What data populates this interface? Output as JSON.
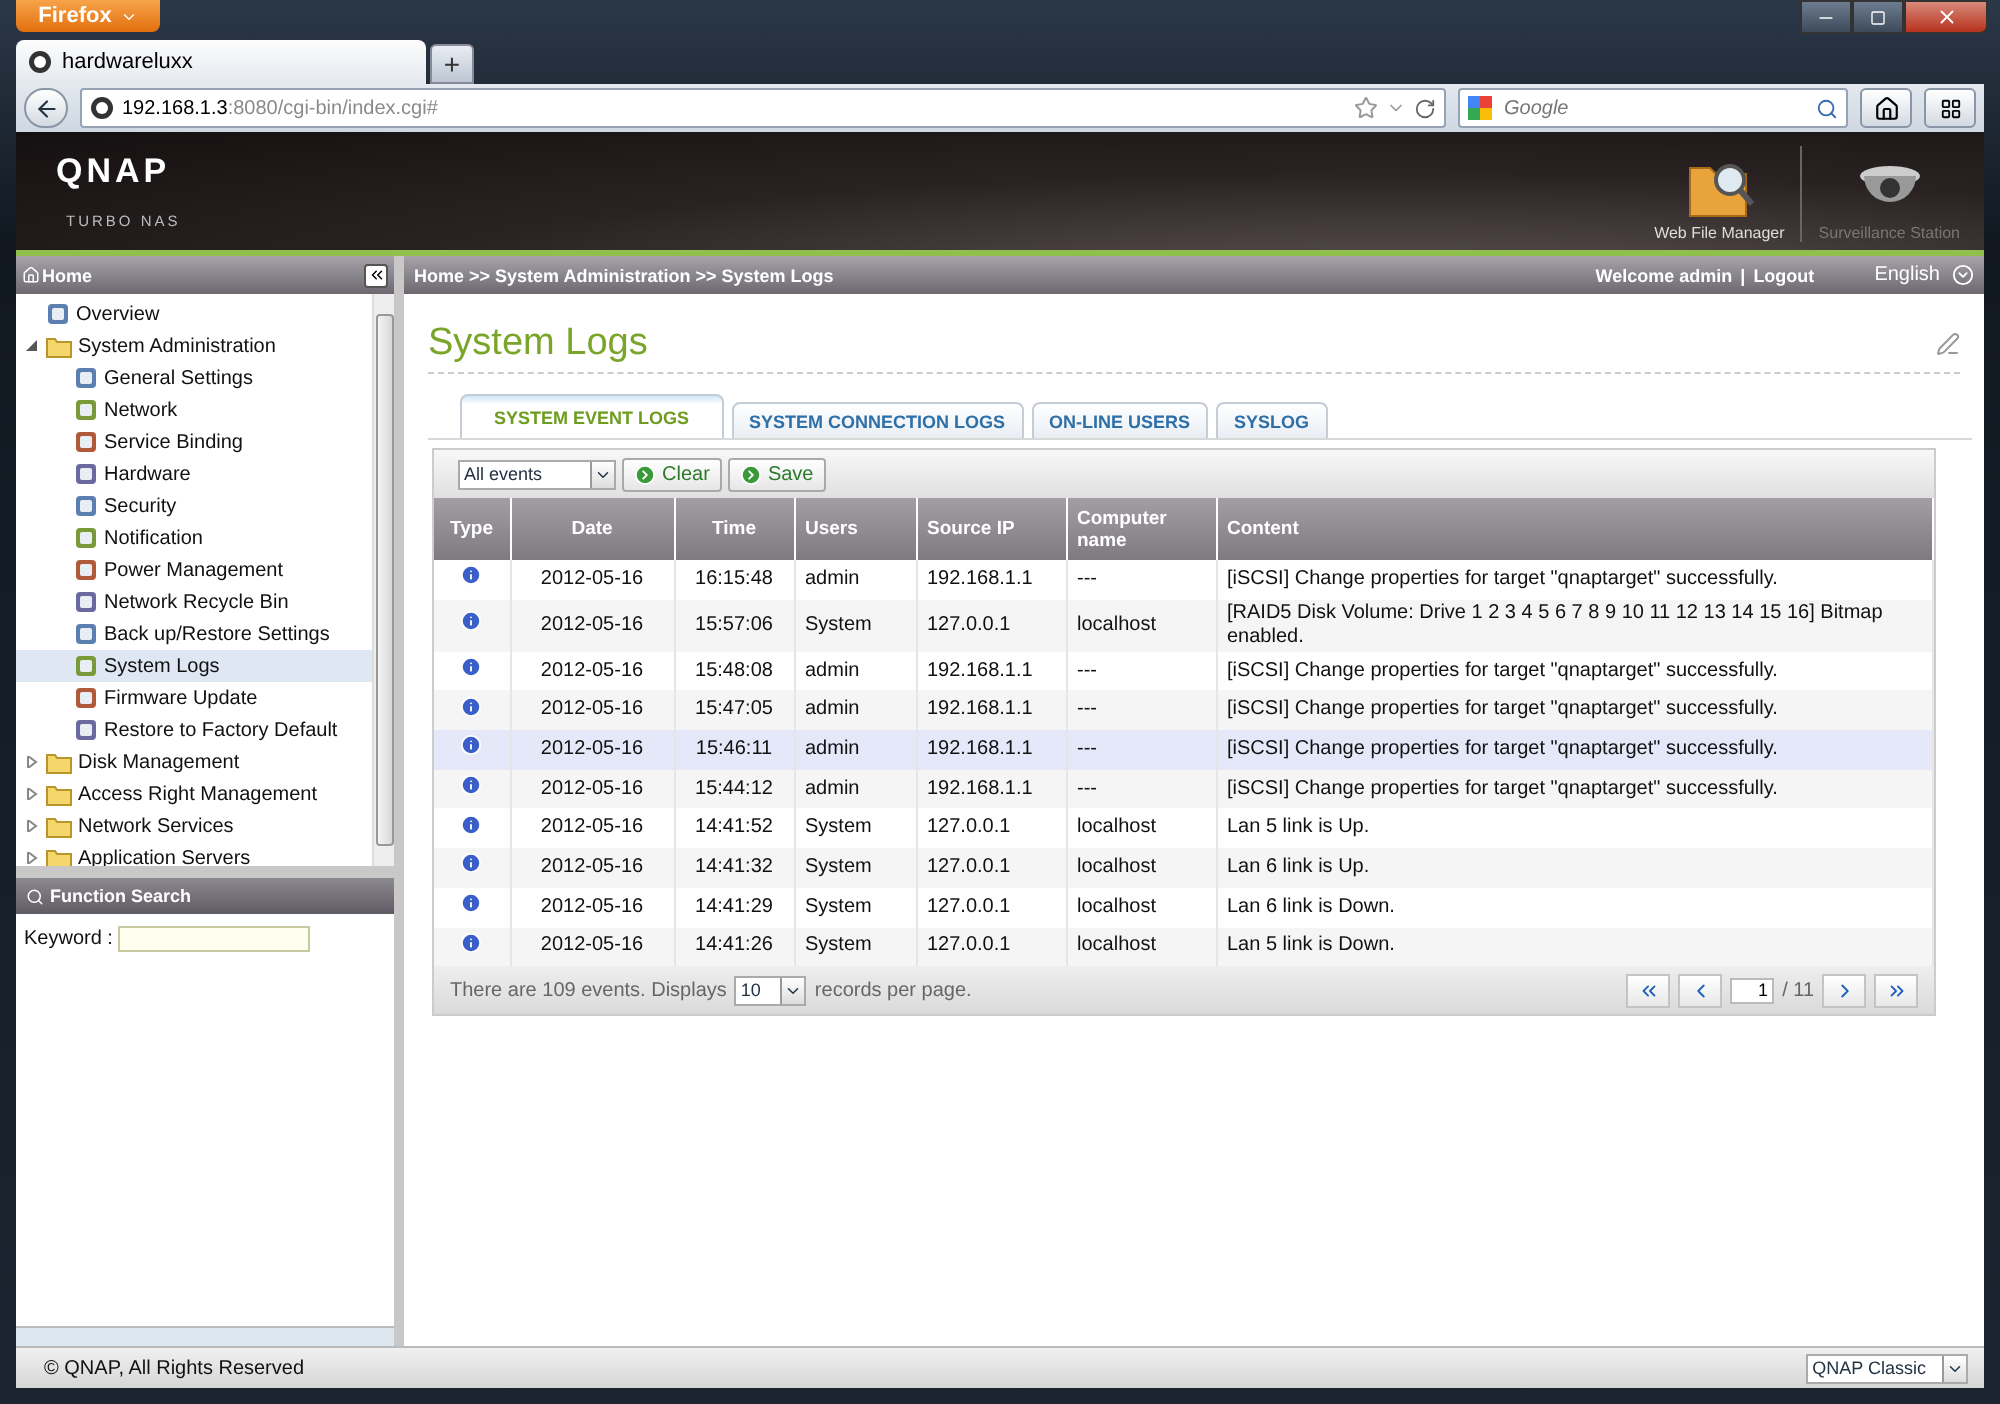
{
  "browser": {
    "menu_button": "Firefox",
    "tab": "hardwareluxx",
    "new_tab": "+",
    "url_host": "192.168.1.3",
    "url_rest": ":8080/cgi-bin/index.cgi#",
    "search": {
      "placeholder": "Google"
    }
  },
  "header": {
    "logo": "QNAP",
    "subtitle": "TURBO NAS",
    "apps": [
      {
        "label": "Web File Manager",
        "kind": "files"
      },
      {
        "label": "Surveillance Station",
        "kind": "camera"
      }
    ]
  },
  "sidebar": {
    "title": "Home",
    "tree": [
      {
        "label": "Overview",
        "kind": "page",
        "selected": false
      },
      {
        "label": "System Administration",
        "kind": "folder",
        "expanded": true,
        "selected": false,
        "children": [
          {
            "label": "General Settings",
            "kind": "page",
            "selected": false
          },
          {
            "label": "Network",
            "kind": "page",
            "selected": false
          },
          {
            "label": "Service Binding",
            "kind": "page",
            "selected": false
          },
          {
            "label": "Hardware",
            "kind": "page",
            "selected": false
          },
          {
            "label": "Security",
            "kind": "page",
            "selected": false
          },
          {
            "label": "Notification",
            "kind": "page",
            "selected": false
          },
          {
            "label": "Power Management",
            "kind": "page",
            "selected": false
          },
          {
            "label": "Network Recycle Bin",
            "kind": "page",
            "selected": false
          },
          {
            "label": "Back up/Restore Settings",
            "kind": "page",
            "selected": false
          },
          {
            "label": "System Logs",
            "kind": "page",
            "selected": true
          },
          {
            "label": "Firmware Update",
            "kind": "page",
            "selected": false
          },
          {
            "label": "Restore to Factory Default",
            "kind": "page",
            "selected": false
          }
        ]
      },
      {
        "label": "Disk Management",
        "kind": "folder",
        "expanded": false,
        "selected": false
      },
      {
        "label": "Access Right Management",
        "kind": "folder",
        "expanded": false,
        "selected": false
      },
      {
        "label": "Network Services",
        "kind": "folder",
        "expanded": false,
        "selected": false
      },
      {
        "label": "Application Servers",
        "kind": "folder",
        "expanded": false,
        "selected": false
      }
    ],
    "search_title": "Function Search",
    "keyword_label": "Keyword :"
  },
  "topbar": {
    "breadcrumb": "Home >> System Administration >> System Logs",
    "welcome": "Welcome admin",
    "separator": "|",
    "logout": "Logout",
    "language": "English"
  },
  "page": {
    "title": "System Logs",
    "tabs": [
      {
        "label": "SYSTEM EVENT LOGS",
        "selected": true
      },
      {
        "label": "SYSTEM CONNECTION LOGS",
        "selected": false
      },
      {
        "label": "ON-LINE USERS",
        "selected": false
      },
      {
        "label": "SYSLOG",
        "selected": false
      }
    ],
    "filter": "All events",
    "buttons": [
      "Clear",
      "Save"
    ],
    "table": {
      "columns": [
        "Type",
        "Date",
        "Time",
        "Users",
        "Source IP",
        "Computer name",
        "Content"
      ],
      "rows": [
        {
          "date": "2012-05-16",
          "time": "16:15:48",
          "user": "admin",
          "ip": "192.168.1.1",
          "computer": "---",
          "content": "[iSCSI] Change properties for target \"qnaptarget\" successfully.",
          "selected": false
        },
        {
          "date": "2012-05-16",
          "time": "15:57:06",
          "user": "System",
          "ip": "127.0.0.1",
          "computer": "localhost",
          "content": "[RAID5 Disk Volume: Drive 1 2 3 4 5 6 7 8 9 10 11 12 13 14 15 16] Bitmap enabled.",
          "selected": false
        },
        {
          "date": "2012-05-16",
          "time": "15:48:08",
          "user": "admin",
          "ip": "192.168.1.1",
          "computer": "---",
          "content": "[iSCSI] Change properties for target \"qnaptarget\" successfully.",
          "selected": false
        },
        {
          "date": "2012-05-16",
          "time": "15:47:05",
          "user": "admin",
          "ip": "192.168.1.1",
          "computer": "---",
          "content": "[iSCSI] Change properties for target \"qnaptarget\" successfully.",
          "selected": false
        },
        {
          "date": "2012-05-16",
          "time": "15:46:11",
          "user": "admin",
          "ip": "192.168.1.1",
          "computer": "---",
          "content": "[iSCSI] Change properties for target \"qnaptarget\" successfully.",
          "selected": true
        },
        {
          "date": "2012-05-16",
          "time": "15:44:12",
          "user": "admin",
          "ip": "192.168.1.1",
          "computer": "---",
          "content": "[iSCSI] Change properties for target \"qnaptarget\" successfully.",
          "selected": false
        },
        {
          "date": "2012-05-16",
          "time": "14:41:52",
          "user": "System",
          "ip": "127.0.0.1",
          "computer": "localhost",
          "content": "Lan 5 link is Up.",
          "selected": false
        },
        {
          "date": "2012-05-16",
          "time": "14:41:32",
          "user": "System",
          "ip": "127.0.0.1",
          "computer": "localhost",
          "content": "Lan 6 link is Up.",
          "selected": false
        },
        {
          "date": "2012-05-16",
          "time": "14:41:29",
          "user": "System",
          "ip": "127.0.0.1",
          "computer": "localhost",
          "content": "Lan 6 link is Down.",
          "selected": false
        },
        {
          "date": "2012-05-16",
          "time": "14:41:26",
          "user": "System",
          "ip": "127.0.0.1",
          "computer": "localhost",
          "content": "Lan 5 link is Down.",
          "selected": false
        }
      ]
    },
    "footer": {
      "summary": "There are 109 events. Displays",
      "per_page": "10",
      "per_page_suffix": "records per page.",
      "page": "1",
      "page_total": "/ 11"
    }
  },
  "status": {
    "copyright": "© QNAP, All Rights Reserved",
    "theme": "QNAP Classic"
  }
}
